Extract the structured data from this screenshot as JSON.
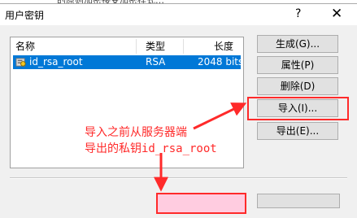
{
  "background": {
    "text": "的原则加密接受加密样式…"
  },
  "window": {
    "title": "用户密钥",
    "help_label": "?",
    "close_label": "✕"
  },
  "list": {
    "columns": [
      "名称",
      "类型",
      "长度"
    ],
    "rows": [
      {
        "name": "id_rsa_root",
        "type": "RSA",
        "length": "2048 bits",
        "icon": "key-icon"
      }
    ]
  },
  "buttons": {
    "generate": "生成(G)...",
    "properties": "属性(P)",
    "delete": "删除(D)",
    "import": "导入(I)...",
    "export": "导出(E)..."
  },
  "annotation": {
    "line1": "导入之前从服务器端",
    "line2": "导出的私钥id_rsa_root"
  },
  "colors": {
    "highlight": "#ff2a2a",
    "selection": "#0078d7"
  }
}
